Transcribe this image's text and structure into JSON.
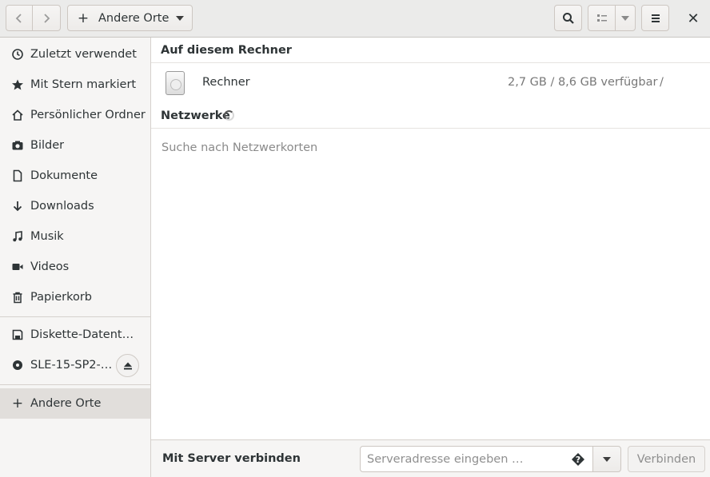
{
  "header": {
    "location_label": "Andere Orte",
    "location_icon": "plus-icon",
    "close_glyph": "✕"
  },
  "sidebar": {
    "items": [
      {
        "label": "Zuletzt verwendet",
        "icon": "clock-icon"
      },
      {
        "label": "Mit Stern markiert",
        "icon": "star-icon"
      },
      {
        "label": "Persönlicher Ordner",
        "icon": "home-icon"
      },
      {
        "label": "Bilder",
        "icon": "camera-icon"
      },
      {
        "label": "Dokumente",
        "icon": "document-icon"
      },
      {
        "label": "Downloads",
        "icon": "download-icon"
      },
      {
        "label": "Musik",
        "icon": "music-icon"
      },
      {
        "label": "Videos",
        "icon": "video-icon"
      },
      {
        "label": "Papierkorb",
        "icon": "trash-icon"
      }
    ],
    "devices": [
      {
        "label": "Diskette-Datenträ…",
        "icon": "floppy-icon"
      },
      {
        "label": "SLE-15-SP2-…",
        "icon": "disc-icon",
        "ejectable": true
      }
    ],
    "other": {
      "label": "Andere Orte",
      "icon": "plus-icon",
      "active": true
    }
  },
  "main": {
    "computer_section": "Auf diesem Rechner",
    "drive": {
      "name": "Rechner",
      "space": "2,7 GB / 8,6 GB verfügbar",
      "mount": "/"
    },
    "network_section": "Netzwerke",
    "network_hint": "Suche nach Netzwerkorten"
  },
  "bottom": {
    "title": "Mit Server verbinden",
    "server_placeholder": "Serveradresse eingeben …",
    "server_value": "",
    "connect_label": "Verbinden"
  }
}
